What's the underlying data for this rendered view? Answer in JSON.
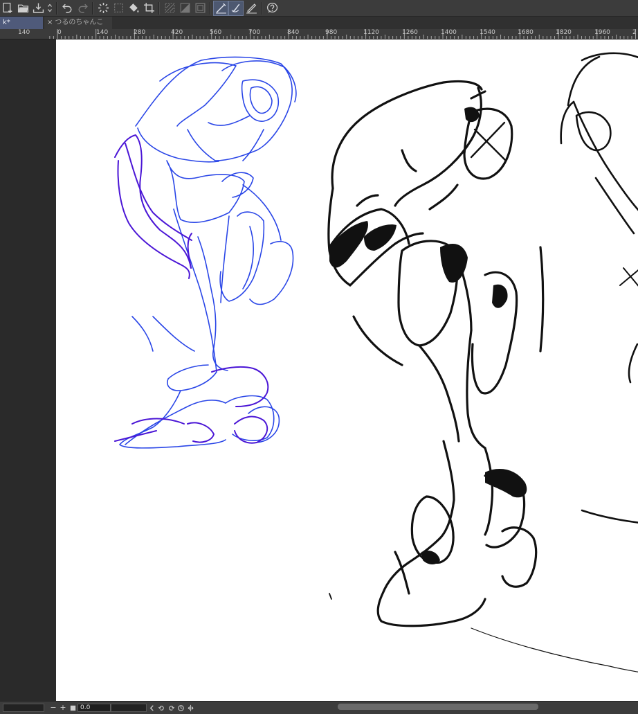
{
  "toolbar": {
    "icons": [
      "new-icon",
      "open-icon",
      "save-icon",
      "updown-icon",
      "undo-icon",
      "redo-icon",
      "spinner-icon",
      "select-icon",
      "fill-icon",
      "crop-icon",
      "hatch-icon",
      "half-icon",
      "frame-icon",
      "pen-active-icon",
      "brush-icon",
      "pencil-icon",
      "help-icon"
    ]
  },
  "tabs": {
    "active_label": "k*",
    "inactive_label": "つるのちゃんこ",
    "close_glyph": "×"
  },
  "ruler": {
    "labels": [
      "140",
      "0",
      "140",
      "280",
      "420",
      "560",
      "700",
      "840",
      "980",
      "1120",
      "1260",
      "1400",
      "1540",
      "1680",
      "1820",
      "1960",
      "2"
    ]
  },
  "status": {
    "minus": "−",
    "plus": "+",
    "value": "0.0"
  },
  "colors": {
    "accent": "#4f5a7a",
    "sketch_blue": "#1f3de6",
    "sketch_purple": "#4b16d6",
    "ink": "#111111"
  }
}
